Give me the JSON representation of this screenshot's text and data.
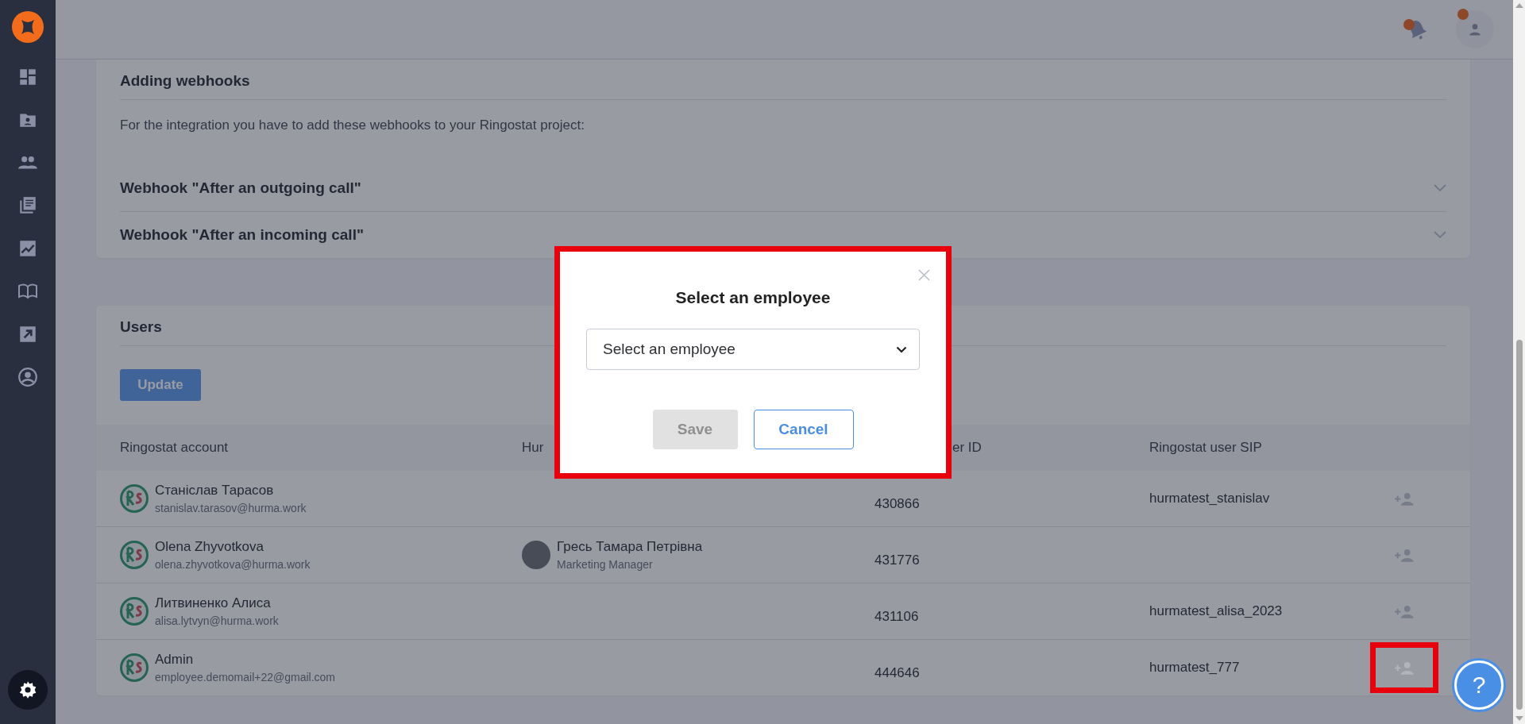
{
  "header": {
    "notifications": {
      "has_badge": true
    },
    "profile": {
      "has_badge": true
    }
  },
  "webhooks": {
    "title": "Adding webhooks",
    "intro": "For the integration you have to add these webhooks to your Ringostat project:",
    "items": [
      {
        "title": "Webhook \"After an outgoing call\"",
        "expanded": false
      },
      {
        "title": "Webhook \"After an incoming call\"",
        "expanded": false
      }
    ]
  },
  "users": {
    "title": "Users",
    "update_button": "Update",
    "columns": [
      "Ringostat account",
      "Hur",
      "er ID",
      "Ringostat user SIP"
    ],
    "rows": [
      {
        "name": "Станіслав Тарасов",
        "email": "stanislav.tarasov@hurma.work",
        "user_id": "430866",
        "sip": "hurmatest_stanislav",
        "highlighted": false
      },
      {
        "name": "Olena Zhyvotkova",
        "email": "olena.zhyvotkova@hurma.work",
        "employee": {
          "name": "Гресь Тамара Петрівна",
          "position": "Marketing Manager"
        },
        "user_id": "431776",
        "highlighted": false
      },
      {
        "name": "Литвиненко Алиса",
        "email": "alisa.lytvyn@hurma.work",
        "user_id": "431106",
        "sip": "hurmatest_alisa_2023",
        "highlighted": false
      },
      {
        "name": "Admin",
        "email": "employee.demomail+22@gmail.com",
        "user_id": "444646",
        "sip": "hurmatest_777",
        "highlighted": true
      }
    ]
  },
  "modal": {
    "title": "Select an employee",
    "select": {
      "placeholder": "Select an employee"
    },
    "buttons": [
      {
        "label": "Save",
        "disabled": true
      },
      {
        "label": "Cancel",
        "disabled": false
      }
    ]
  },
  "help": {
    "label": "?"
  }
}
